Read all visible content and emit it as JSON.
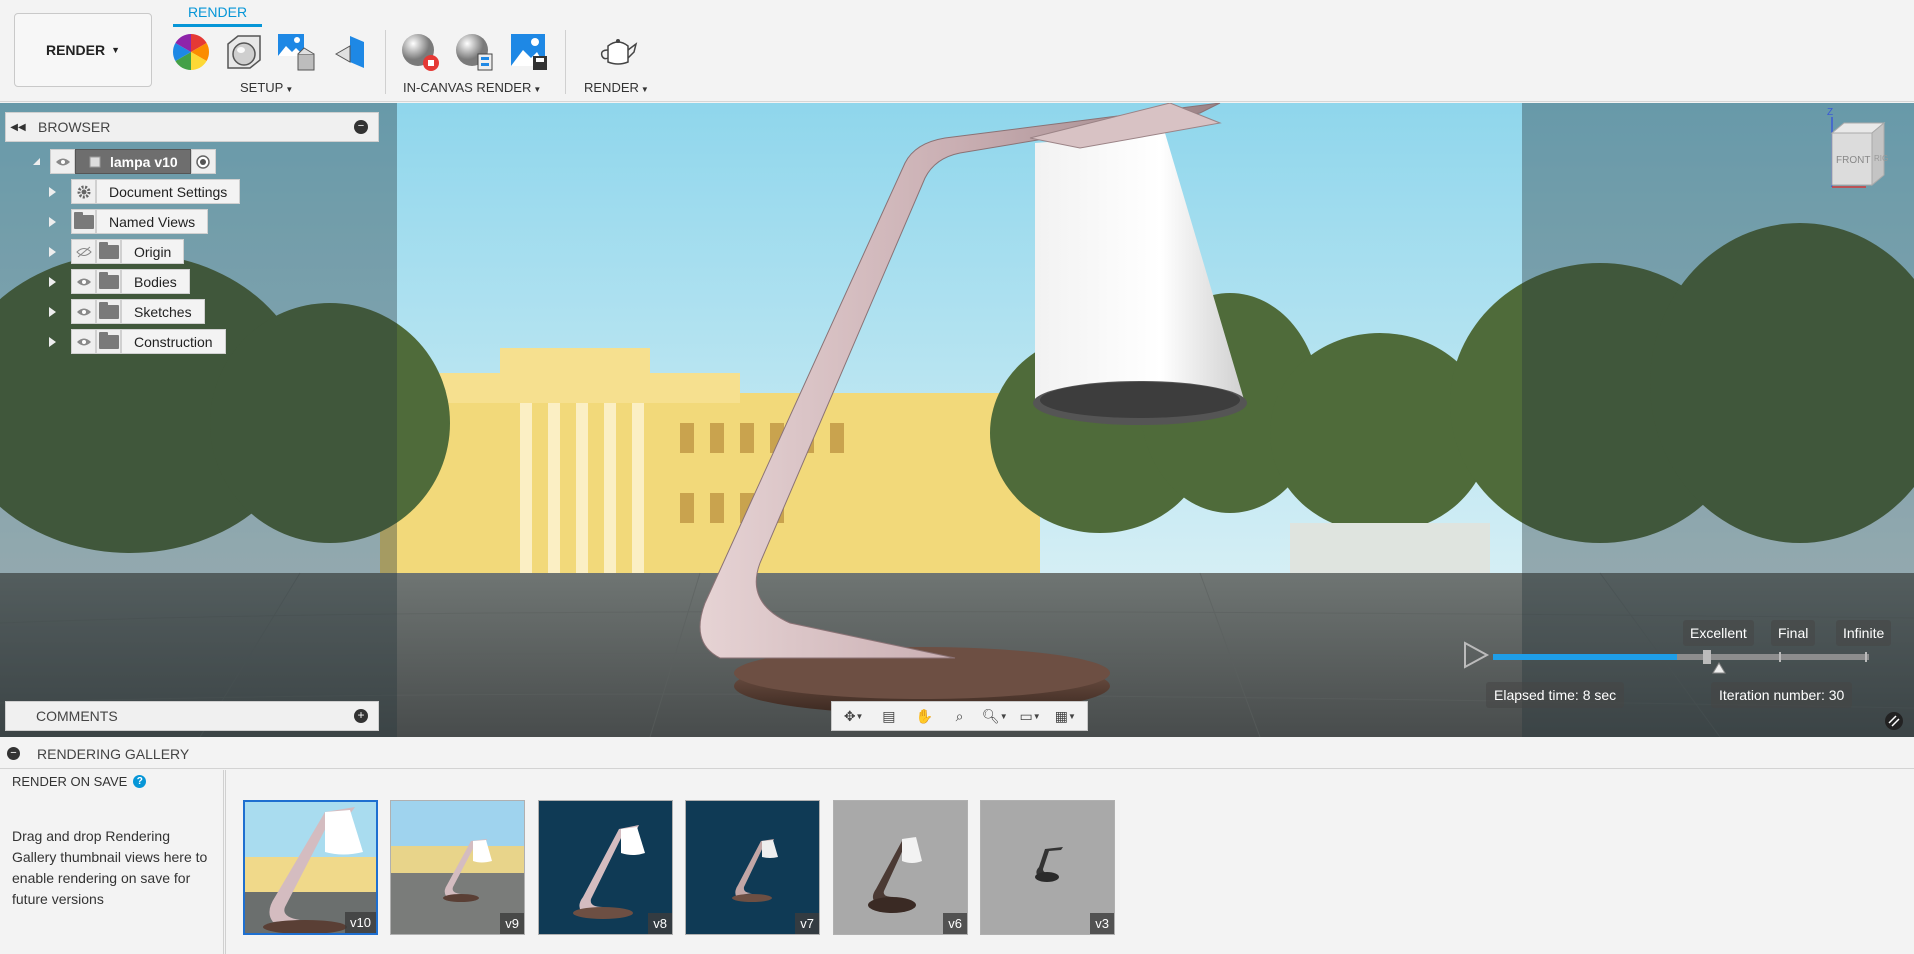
{
  "toolbar": {
    "workspace_label": "RENDER",
    "active_tab": "RENDER",
    "groups": [
      {
        "label": "SETUP"
      },
      {
        "label": "IN-CANVAS RENDER"
      },
      {
        "label": "RENDER"
      }
    ],
    "icons": [
      "appearance-icon",
      "scene-settings-icon",
      "texture-map-icon",
      "decal-icon",
      "stop-render-icon",
      "in-canvas-settings-icon",
      "capture-image-icon",
      "render-teapot-icon"
    ]
  },
  "browser": {
    "title": "BROWSER",
    "root": {
      "label": "lampa v10"
    },
    "items": [
      {
        "label": "Document Settings",
        "icon": "gear-icon"
      },
      {
        "label": "Named Views",
        "icon": "folder-icon"
      },
      {
        "label": "Origin",
        "icon": "folder-icon",
        "visibility": "hidden"
      },
      {
        "label": "Bodies",
        "icon": "folder-icon",
        "visibility": "visible"
      },
      {
        "label": "Sketches",
        "icon": "folder-icon",
        "visibility": "visible"
      },
      {
        "label": "Construction",
        "icon": "folder-icon",
        "visibility": "visible"
      }
    ]
  },
  "comments": {
    "title": "COMMENTS"
  },
  "viewcube": {
    "front": "FRONT",
    "right": "RIG",
    "axis": "Z"
  },
  "render_progress": {
    "quality_options": [
      "Excellent",
      "Final",
      "Infinite"
    ],
    "progress_fraction": 0.49,
    "elapsed_time": "Elapsed time: 8 sec",
    "iteration": "Iteration number: 30"
  },
  "navbar": {
    "tools": [
      "orbit-icon",
      "look-at-icon",
      "pan-icon",
      "zoom-icon",
      "fit-icon",
      "display-settings-icon",
      "grid-icon"
    ]
  },
  "gallery": {
    "title": "RENDERING GALLERY",
    "render_on_save": "RENDER ON SAVE",
    "help": "?",
    "description": "Drag and drop Rendering Gallery thumbnail views here to enable rendering on save for future versions",
    "thumbnails": [
      {
        "version": "v10",
        "selected": true,
        "background": "outdoor"
      },
      {
        "version": "v9",
        "selected": false,
        "background": "outdoor"
      },
      {
        "version": "v8",
        "selected": false,
        "background": "#0f3a55"
      },
      {
        "version": "v7",
        "selected": false,
        "background": "#0f3a55"
      },
      {
        "version": "v6",
        "selected": false,
        "background": "#a9a9a9"
      },
      {
        "version": "v3",
        "selected": false,
        "background": "#a9a9a9"
      }
    ]
  },
  "colors": {
    "accent": "#0696d7",
    "progress": "#1e9ee8",
    "lamp_metal": "#c9aeb2",
    "lamp_base": "#5a3f35"
  }
}
